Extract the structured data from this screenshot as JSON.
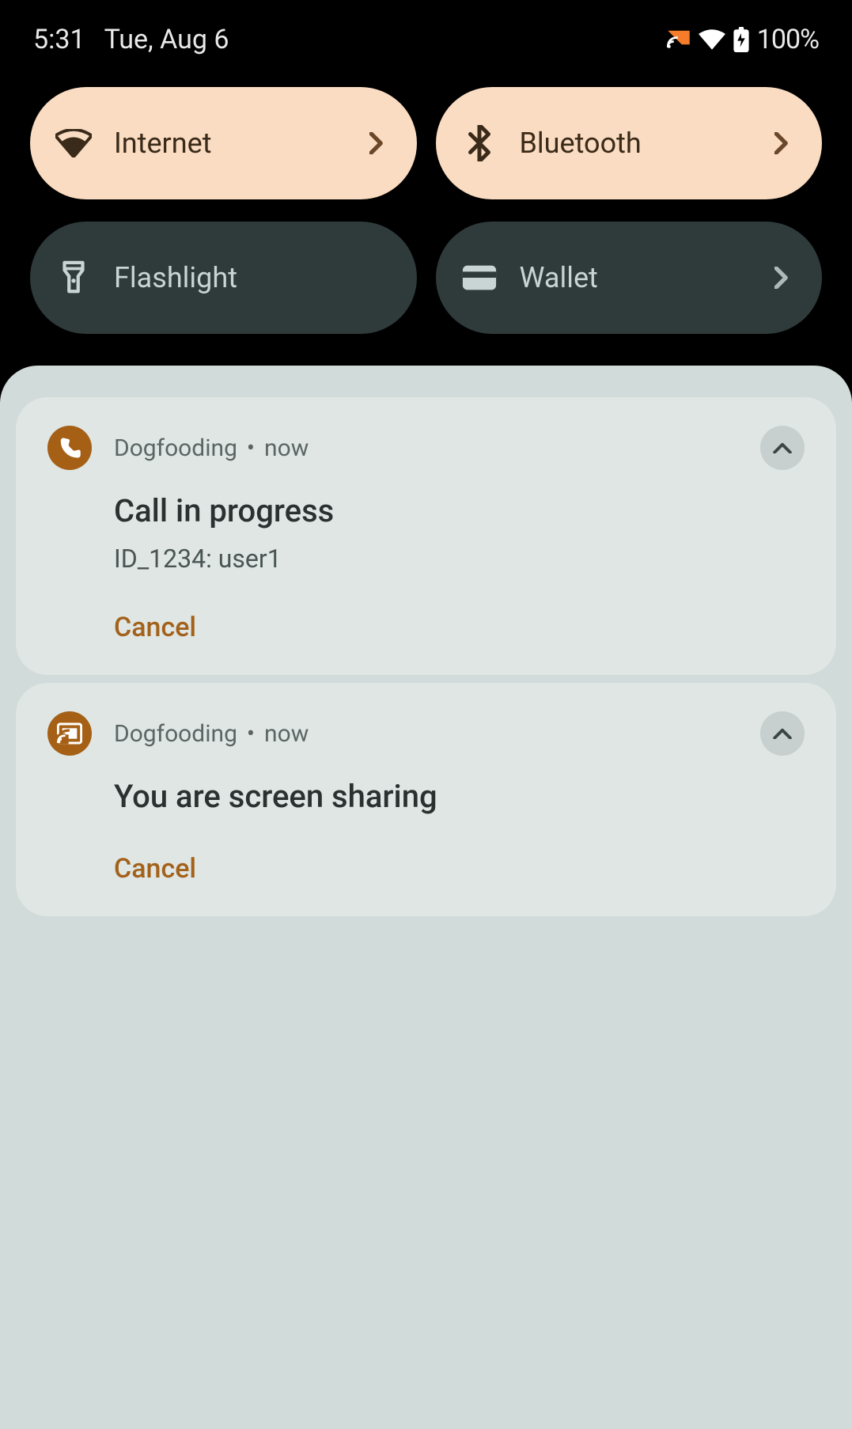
{
  "status": {
    "time": "5:31",
    "date": "Tue, Aug 6",
    "battery": "100%"
  },
  "qs": {
    "tiles": [
      {
        "label": "Internet",
        "icon": "wifi-icon",
        "active": true,
        "chevron": true
      },
      {
        "label": "Bluetooth",
        "icon": "bluetooth-icon",
        "active": true,
        "chevron": true
      },
      {
        "label": "Flashlight",
        "icon": "flashlight-icon",
        "active": false,
        "chevron": false
      },
      {
        "label": "Wallet",
        "icon": "wallet-icon",
        "active": false,
        "chevron": true
      }
    ]
  },
  "notifications": [
    {
      "app": "Dogfooding",
      "time": "now",
      "icon": "phone-icon",
      "title": "Call in progress",
      "text": "ID_1234: user1",
      "action": "Cancel"
    },
    {
      "app": "Dogfooding",
      "time": "now",
      "icon": "cast-icon",
      "title": "You are screen sharing",
      "text": "",
      "action": "Cancel"
    }
  ],
  "colors": {
    "tile_active_bg": "#fadcc2",
    "tile_inactive_bg": "#2f3a3a",
    "accent": "#a56016"
  }
}
